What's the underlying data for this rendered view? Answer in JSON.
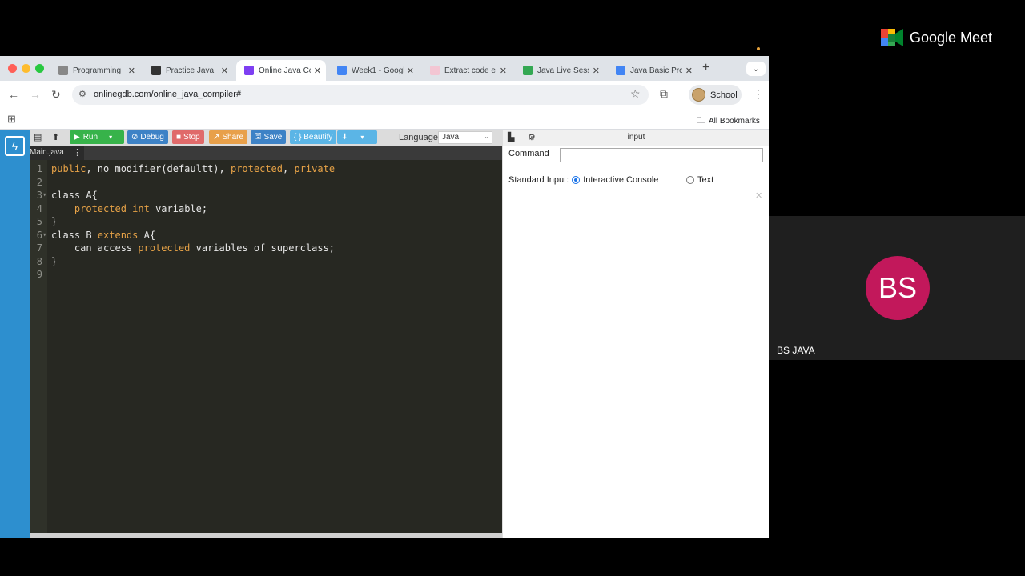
{
  "browser": {
    "tabs": [
      {
        "title": "Programming",
        "icon": "globe-icon",
        "color": "#888888"
      },
      {
        "title": "Practice Java",
        "icon": "site-icon",
        "color": "#333333"
      },
      {
        "title": "Online Java Co",
        "icon": "gdb-icon",
        "color": "#7e3ff2"
      },
      {
        "title": "Week1 - Googl",
        "icon": "docs-icon",
        "color": "#4285f4"
      },
      {
        "title": "Extract code e",
        "icon": "site-icon",
        "color": "#f3c6d3"
      },
      {
        "title": "Java Live Sess",
        "icon": "drive-icon",
        "color": "#34a853"
      },
      {
        "title": "Java Basic Pro",
        "icon": "docs-icon",
        "color": "#4285f4"
      }
    ],
    "new_tab": "+",
    "url": "onlinegdb.com/online_java_compiler#",
    "profile_label": "School",
    "bookmarks_label": "All Bookmarks"
  },
  "ide": {
    "toolbar": {
      "run": "Run",
      "debug": "Debug",
      "stop": "Stop",
      "share": "Share",
      "save": "Save",
      "beautify": "{ } Beautify",
      "language_label": "Language",
      "language_value": "Java"
    },
    "file_tab": "Main.java",
    "code_lines": [
      {
        "n": "1",
        "fold": "",
        "parts": [
          {
            "t": "public",
            "k": true
          },
          {
            "t": ", no modifier(defaultt), ",
            "k": false
          },
          {
            "t": "protected",
            "k": true
          },
          {
            "t": ", ",
            "k": false
          },
          {
            "t": "private",
            "k": true
          }
        ]
      },
      {
        "n": "2",
        "fold": "",
        "parts": []
      },
      {
        "n": "3",
        "fold": "▾",
        "parts": [
          {
            "t": "class A{",
            "k": false
          }
        ]
      },
      {
        "n": "4",
        "fold": "",
        "parts": [
          {
            "t": "    ",
            "k": false
          },
          {
            "t": "protected",
            "k": true
          },
          {
            "t": " ",
            "k": false
          },
          {
            "t": "int",
            "k": true
          },
          {
            "t": " variable;",
            "k": false
          }
        ]
      },
      {
        "n": "5",
        "fold": "",
        "parts": [
          {
            "t": "}",
            "k": false
          }
        ]
      },
      {
        "n": "6",
        "fold": "▾",
        "parts": [
          {
            "t": "class B ",
            "k": false
          },
          {
            "t": "extends",
            "k": true
          },
          {
            "t": " A{",
            "k": false
          }
        ]
      },
      {
        "n": "7",
        "fold": "",
        "parts": [
          {
            "t": "    can access ",
            "k": false
          },
          {
            "t": "protected",
            "k": true
          },
          {
            "t": " variables of superclass;",
            "k": false
          }
        ]
      },
      {
        "n": "8",
        "fold": "",
        "parts": [
          {
            "t": "}",
            "k": false
          }
        ]
      },
      {
        "n": "9",
        "fold": "",
        "parts": []
      }
    ]
  },
  "input_panel": {
    "title": "input",
    "command_label": "Command",
    "stdin_label": "Standard Input:",
    "option_console": "Interactive Console",
    "option_text": "Text",
    "selected": "Interactive Console"
  },
  "meet": {
    "logo_text": "Google Meet",
    "participant_initials": "BS",
    "participant_name": "BS JAVA",
    "avatar_color": "#c2185b"
  }
}
